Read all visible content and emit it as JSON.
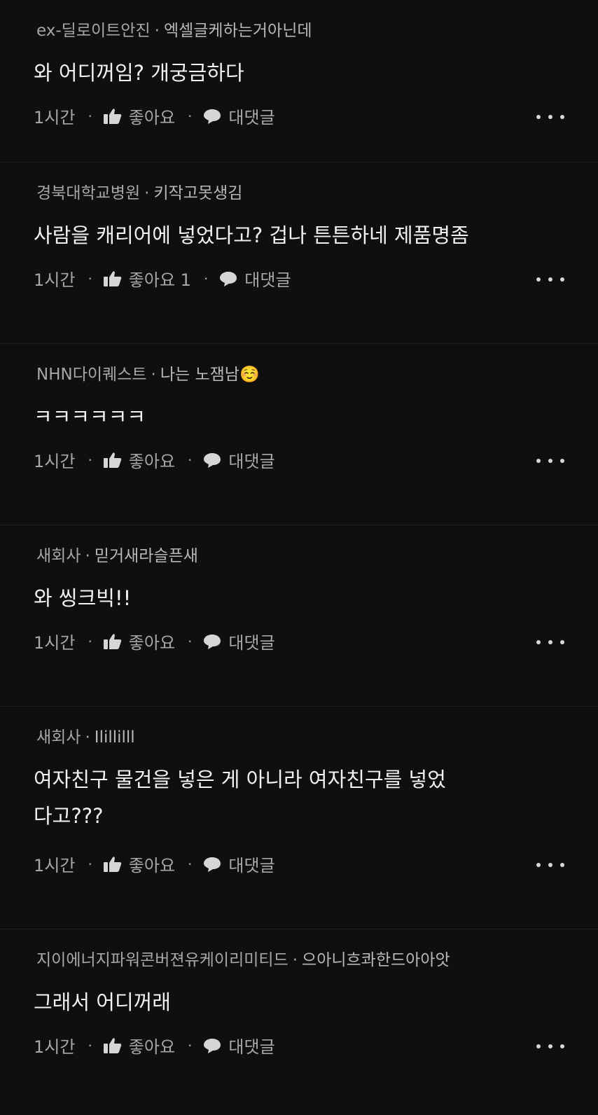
{
  "comments": [
    {
      "company": "ex-딜로이트안진",
      "nickname": "엑셀글케하는거아닌데",
      "text": "와 어디꺼임? 개궁금하다",
      "time": "1시간",
      "like_label": "좋아요",
      "reply_label": "대댓글"
    },
    {
      "company": "경북대학교병원",
      "nickname": "키작고못생김",
      "text": "사람을 캐리어에 넣었다고? 겁나 튼튼하네 제품명좀",
      "time": "1시간",
      "like_label": "좋아요 1",
      "reply_label": "대댓글"
    },
    {
      "company": "NHN다이퀘스트",
      "nickname": "나는 노잼남☺️",
      "text": "ㅋㅋㅋㅋㅋㅋ",
      "time": "1시간",
      "like_label": "좋아요",
      "reply_label": "대댓글"
    },
    {
      "company": "새회사",
      "nickname": "믿거새라슬픈새",
      "text": "와 씽크빅!!",
      "time": "1시간",
      "like_label": "좋아요",
      "reply_label": "대댓글"
    },
    {
      "company": "새회사",
      "nickname": "Ilillilll",
      "text": "여자친구 물건을 넣은 게 아니라 여자친구를 넣었다고???",
      "time": "1시간",
      "like_label": "좋아요",
      "reply_label": "대댓글"
    },
    {
      "company": "지이에너지파워콘버젼유케이리미티드",
      "nickname": "으아니흐콰한드아아앗",
      "text": "그래서 어디꺼래",
      "time": "1시간",
      "like_label": "좋아요",
      "reply_label": "대댓글"
    }
  ],
  "separator": "·"
}
